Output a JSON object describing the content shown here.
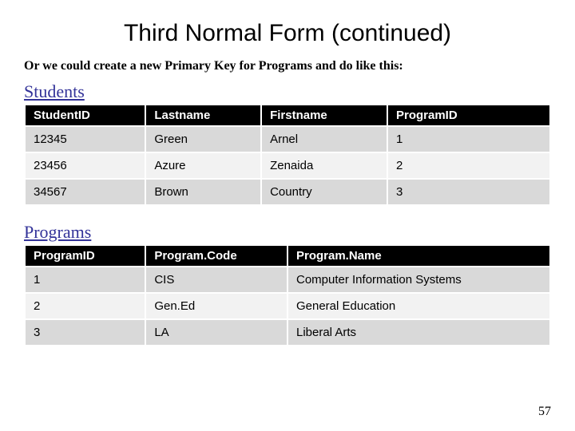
{
  "title": "Third Normal Form (continued)",
  "subtitle": "Or we could create a new Primary Key for Programs and do like this:",
  "tables": {
    "students": {
      "label": "Students",
      "headers": [
        "StudentID",
        "Lastname",
        "Firstname",
        "ProgramID"
      ],
      "rows": [
        [
          "12345",
          "Green",
          "Arnel",
          "1"
        ],
        [
          "23456",
          "Azure",
          "Zenaida",
          "2"
        ],
        [
          "34567",
          "Brown",
          "Country",
          "3"
        ]
      ]
    },
    "programs": {
      "label": "Programs",
      "headers": [
        "ProgramID",
        "Program.Code",
        "Program.Name"
      ],
      "rows": [
        [
          "1",
          "CIS",
          "Computer Information Systems"
        ],
        [
          "2",
          "Gen.Ed",
          "General Education"
        ],
        [
          "3",
          "LA",
          "Liberal Arts"
        ]
      ]
    }
  },
  "page_number": "57"
}
